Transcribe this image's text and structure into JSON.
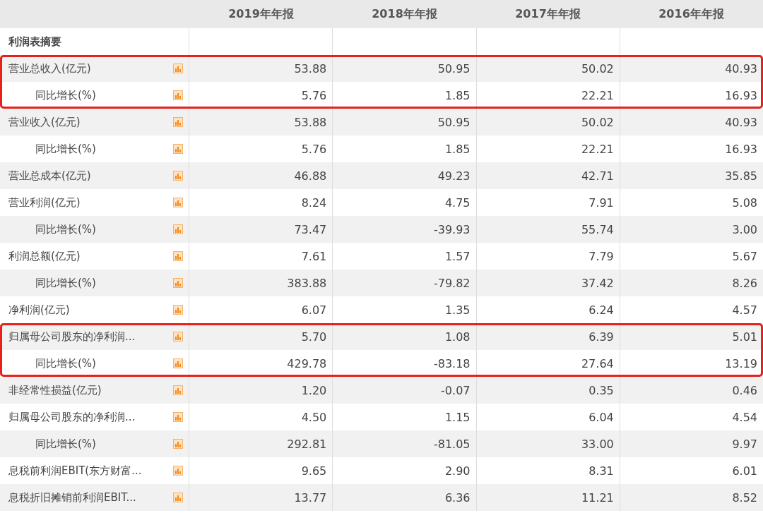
{
  "table": {
    "columns": [
      "2019年年报",
      "2018年年报",
      "2017年年报",
      "2016年年报"
    ],
    "section_title": "利润表摘要",
    "rows": [
      {
        "label": "营业总收入(亿元)",
        "values": [
          "53.88",
          "50.95",
          "50.02",
          "40.93"
        ],
        "highlighted": true,
        "children": [
          {
            "label": "同比增长(%)",
            "values": [
              "5.76",
              "1.85",
              "22.21",
              "16.93"
            ]
          }
        ]
      },
      {
        "label": "营业收入(亿元)",
        "values": [
          "53.88",
          "50.95",
          "50.02",
          "40.93"
        ],
        "highlighted": false,
        "children": [
          {
            "label": "同比增长(%)",
            "values": [
              "5.76",
              "1.85",
              "22.21",
              "16.93"
            ]
          }
        ]
      },
      {
        "label": "营业总成本(亿元)",
        "values": [
          "46.88",
          "49.23",
          "42.71",
          "35.85"
        ],
        "highlighted": false
      },
      {
        "label": "营业利润(亿元)",
        "values": [
          "8.24",
          "4.75",
          "7.91",
          "5.08"
        ],
        "highlighted": false,
        "children": [
          {
            "label": "同比增长(%)",
            "values": [
              "73.47",
              "-39.93",
              "55.74",
              "3.00"
            ]
          }
        ]
      },
      {
        "label": "利润总额(亿元)",
        "values": [
          "7.61",
          "1.57",
          "7.79",
          "5.67"
        ],
        "highlighted": false,
        "children": [
          {
            "label": "同比增长(%)",
            "values": [
              "383.88",
              "-79.82",
              "37.42",
              "8.26"
            ]
          }
        ]
      },
      {
        "label": "净利润(亿元)",
        "values": [
          "6.07",
          "1.35",
          "6.24",
          "4.57"
        ],
        "highlighted": false
      },
      {
        "label": "归属母公司股东的净利润...",
        "values": [
          "5.70",
          "1.08",
          "6.39",
          "5.01"
        ],
        "highlighted": true,
        "children": [
          {
            "label": "同比增长(%)",
            "values": [
              "429.78",
              "-83.18",
              "27.64",
              "13.19"
            ]
          }
        ]
      },
      {
        "label": "非经常性损益(亿元)",
        "values": [
          "1.20",
          "-0.07",
          "0.35",
          "0.46"
        ],
        "highlighted": false
      },
      {
        "label": "归属母公司股东的净利润...",
        "values": [
          "4.50",
          "1.15",
          "6.04",
          "4.54"
        ],
        "highlighted": false,
        "children": [
          {
            "label": "同比增长(%)",
            "values": [
              "292.81",
              "-81.05",
              "33.00",
              "9.97"
            ]
          }
        ]
      },
      {
        "label": "息税前利润EBIT(东方财富...",
        "values": [
          "9.65",
          "2.90",
          "8.31",
          "6.01"
        ],
        "highlighted": false
      },
      {
        "label": "息税折旧摊销前利润EBIT...",
        "values": [
          "13.77",
          "6.36",
          "11.21",
          "8.52"
        ],
        "highlighted": false
      }
    ]
  }
}
